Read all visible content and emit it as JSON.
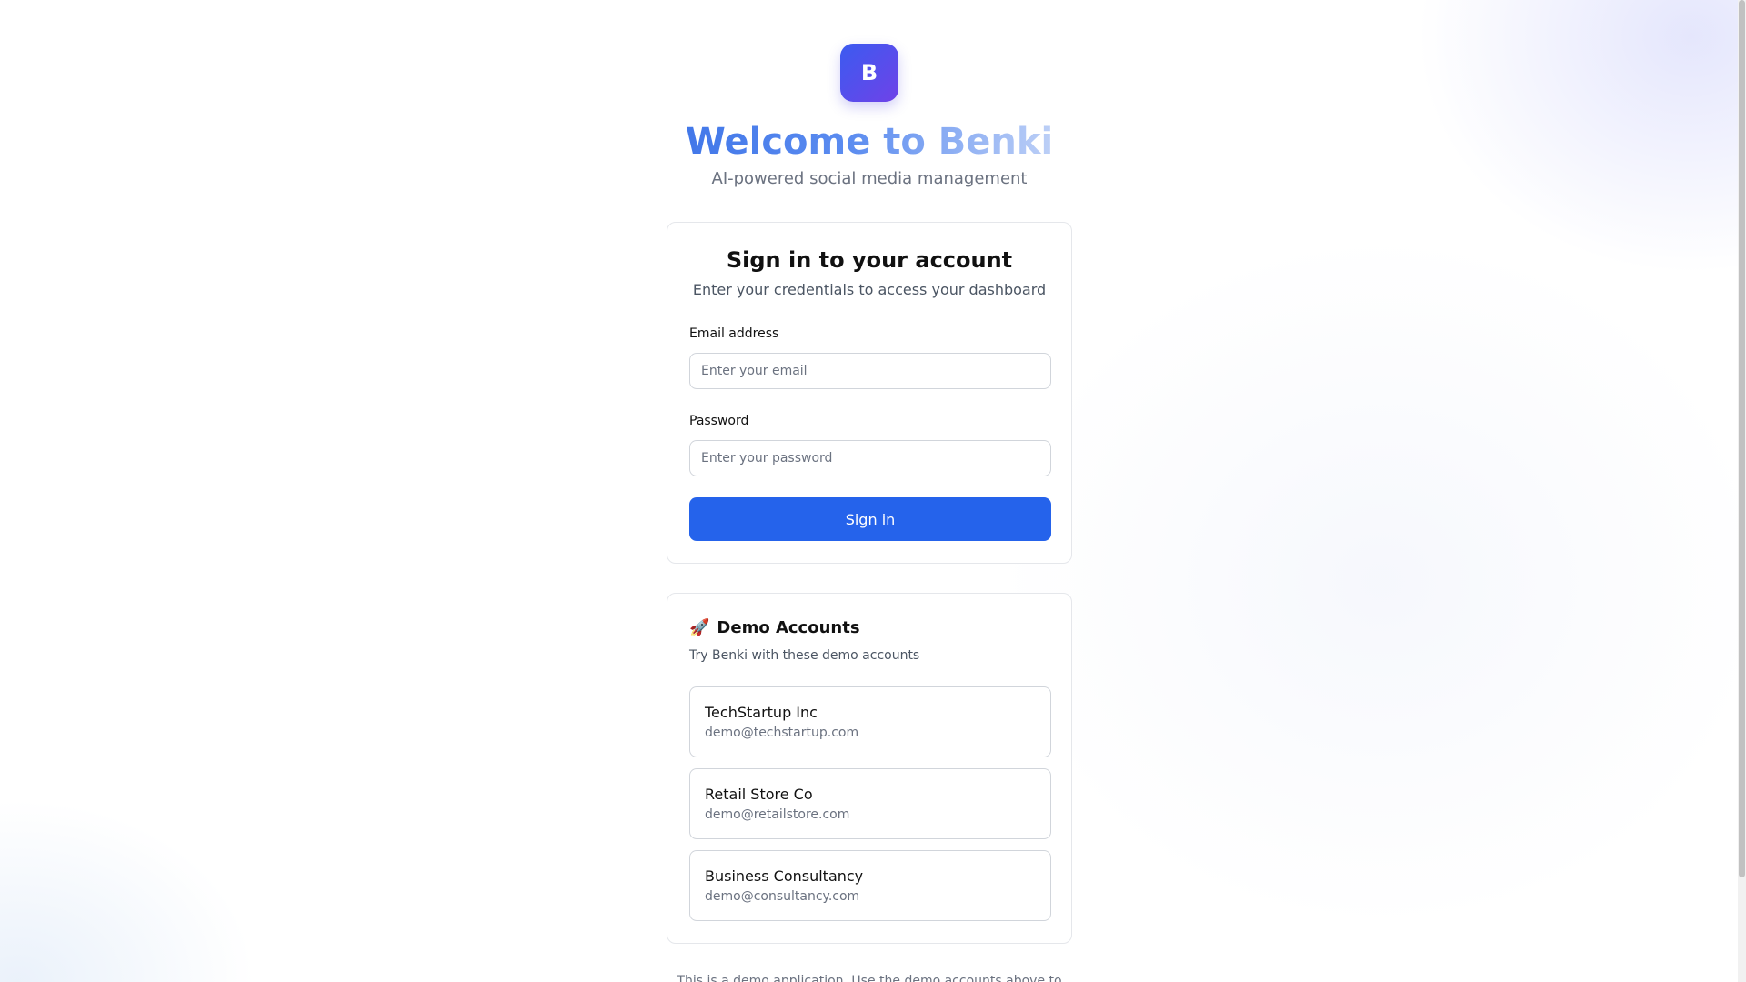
{
  "brand": {
    "logo_letter": "B",
    "welcome": "Welcome to Benki",
    "tagline": "AI-powered social media management"
  },
  "signin": {
    "title": "Sign in to your account",
    "subtitle": "Enter your credentials to access your dashboard",
    "email_label": "Email address",
    "email_placeholder": "Enter your email",
    "email_value": "",
    "password_label": "Password",
    "password_placeholder": "Enter your password",
    "password_value": "",
    "button_label": "Sign in"
  },
  "demo": {
    "icon": "rocket-icon",
    "icon_glyph": "🚀",
    "title": "Demo Accounts",
    "subtitle": "Try Benki with these demo accounts",
    "accounts": [
      {
        "name": "TechStartup Inc",
        "email": "demo@techstartup.com"
      },
      {
        "name": "Retail Store Co",
        "email": "demo@retailstore.com"
      },
      {
        "name": "Business Consultancy",
        "email": "demo@consultancy.com"
      }
    ]
  },
  "footer": {
    "note": "This is a demo application. Use the demo accounts above to"
  },
  "colors": {
    "primary": "#2563eb",
    "logo_gradient_start": "#3b5bf0",
    "logo_gradient_end": "#6f42e8"
  }
}
